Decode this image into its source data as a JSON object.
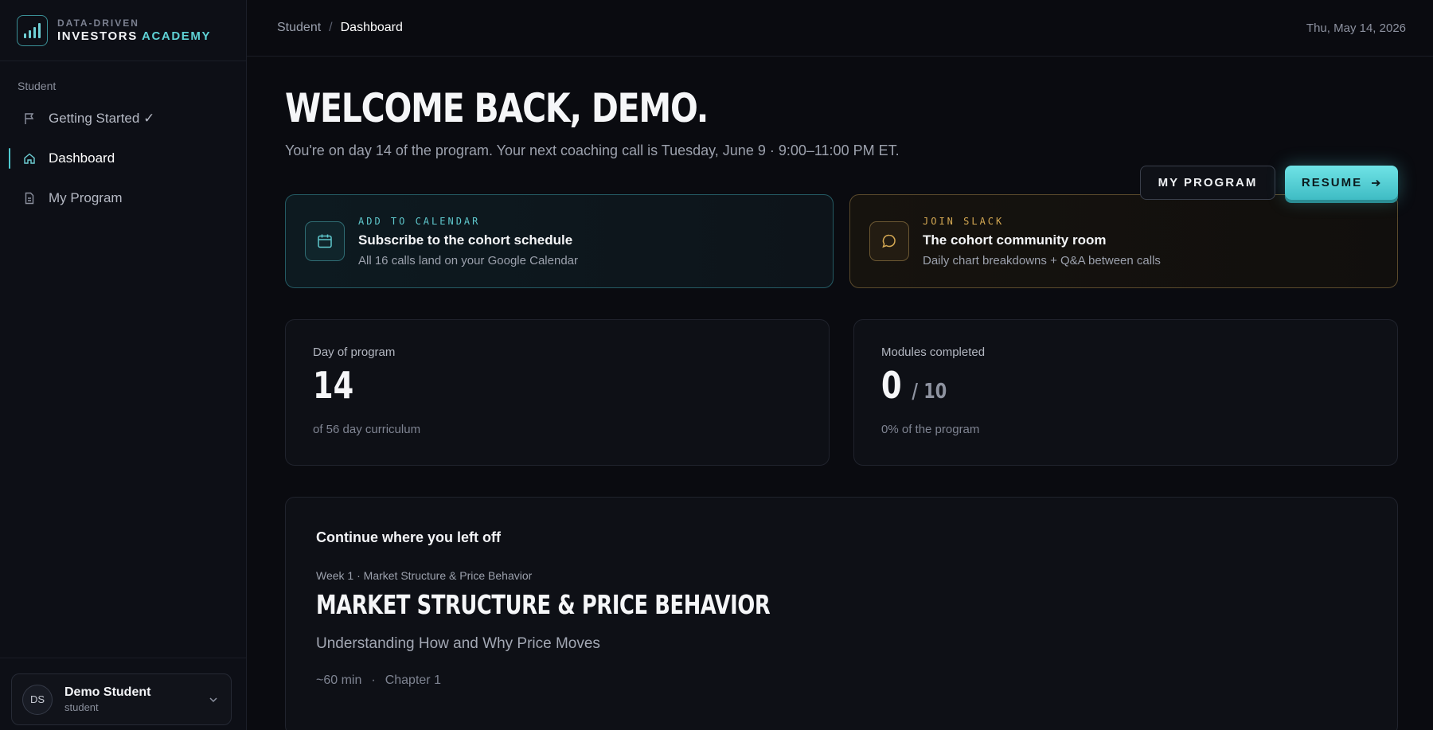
{
  "brand": {
    "top": "DATA-DRIVEN",
    "bottom_main": "INVESTORS",
    "bottom_accent": "ACADEMY"
  },
  "sidebar": {
    "section": "Student",
    "items": [
      {
        "label": "Getting Started ✓",
        "icon": "flag-icon"
      },
      {
        "label": "Dashboard",
        "icon": "home-icon"
      },
      {
        "label": "My Program",
        "icon": "document-icon"
      }
    ],
    "user": {
      "initials": "DS",
      "name": "Demo Student",
      "role": "student"
    }
  },
  "topbar": {
    "crumb_parent": "Student",
    "crumb_sep": "/",
    "crumb_current": "Dashboard",
    "date": "Thu, May 14, 2026"
  },
  "header": {
    "title": "WELCOME BACK, DEMO.",
    "subtitle": "You're on day 14 of the program. Your next coaching call is Tuesday, June 9 · 9:00–11:00 PM ET.",
    "btn_program": "MY PROGRAM",
    "btn_resume": "RESUME"
  },
  "promos": {
    "calendar": {
      "eyebrow": "ADD TO CALENDAR",
      "title": "Subscribe to the cohort schedule",
      "desc": "All 16 calls land on your Google Calendar"
    },
    "slack": {
      "eyebrow": "JOIN SLACK",
      "title": "The cohort community room",
      "desc": "Daily chart breakdowns + Q&A between calls"
    }
  },
  "stats": {
    "day": {
      "label": "Day of program",
      "value": "14",
      "sub": "of 56 day curriculum"
    },
    "modules": {
      "label": "Modules completed",
      "value": "0",
      "of": "/ 10",
      "sub": "0% of the program"
    }
  },
  "continue": {
    "heading": "Continue where you left off",
    "eyebrow": "Week 1 · Market Structure & Price Behavior",
    "title": "MARKET STRUCTURE & PRICE BEHAVIOR",
    "subtitle": "Understanding How and Why Price Moves",
    "duration": "~60 min",
    "dot": "·",
    "chapter": "Chapter 1"
  },
  "colors": {
    "accent": "#4fc9cf",
    "gold": "#d4a853",
    "background": "#0a0b10"
  }
}
